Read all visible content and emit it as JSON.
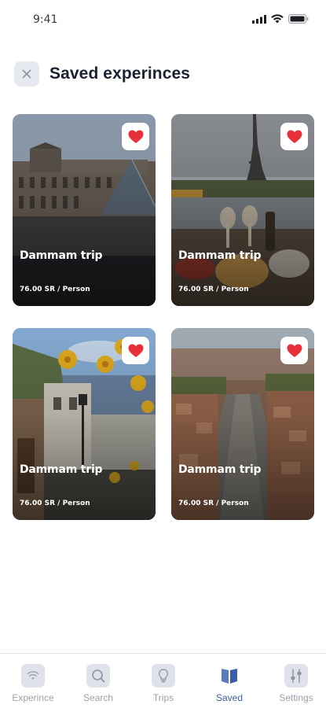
{
  "status_bar": {
    "time": "9:41"
  },
  "header": {
    "title": "Saved experinces"
  },
  "cards": [
    {
      "title": "Dammam trip",
      "price": "76.00 SR / Person",
      "image": "louvre-photo"
    },
    {
      "title": "Dammam trip",
      "price": "76.00 SR / Person",
      "image": "eiffel-tower-photo"
    },
    {
      "title": "Dammam trip",
      "price": "76.00 SR / Person",
      "image": "flower-street-photo"
    },
    {
      "title": "Dammam trip",
      "price": "76.00 SR / Person",
      "image": "city-aerial-photo"
    }
  ],
  "tabs": [
    {
      "label": "Experince",
      "icon": "wifi-icon"
    },
    {
      "label": "Search",
      "icon": "search-icon"
    },
    {
      "label": "Trips",
      "icon": "lightbulb-icon"
    },
    {
      "label": "Saved",
      "icon": "bookmark-icon",
      "active": true
    },
    {
      "label": "Settings",
      "icon": "sliders-icon"
    }
  ],
  "colors": {
    "accent": "#3b5ea8",
    "heart": "#e8303a",
    "inactive": "#9aa0ab"
  }
}
